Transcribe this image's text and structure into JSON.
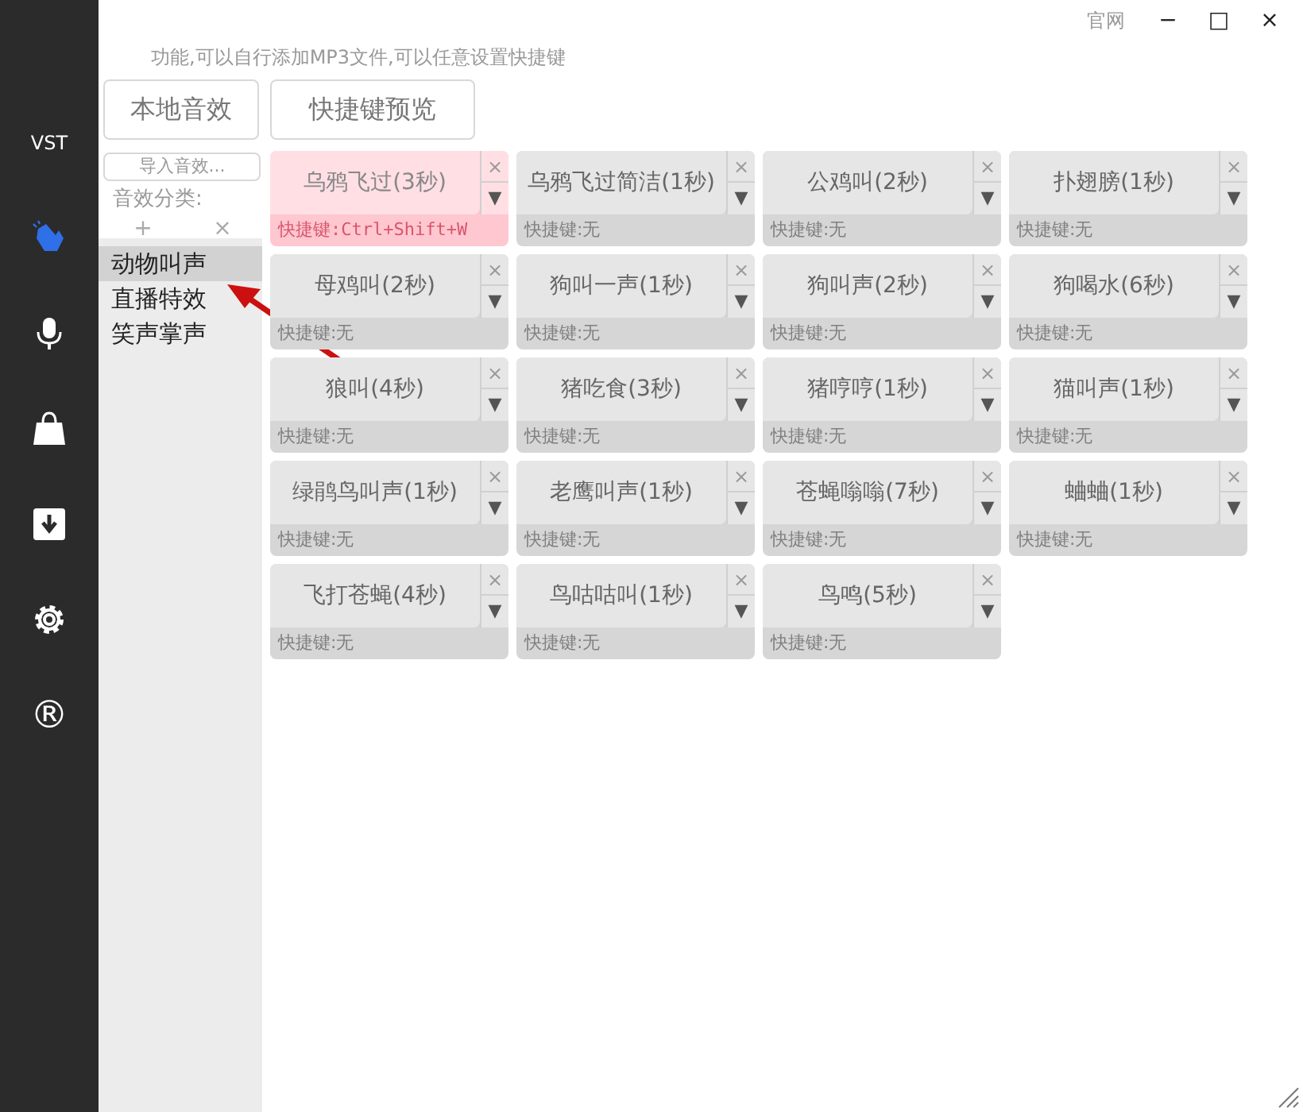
{
  "window": {
    "link": "官网",
    "controls": [
      "−",
      "□",
      "×"
    ]
  },
  "nav": [
    {
      "kind": "text",
      "label": "VST",
      "selected": false
    },
    {
      "kind": "clap",
      "selected": true
    },
    {
      "kind": "mic",
      "selected": false
    },
    {
      "kind": "bag",
      "selected": false
    },
    {
      "kind": "download",
      "selected": false
    },
    {
      "kind": "gear",
      "selected": false
    },
    {
      "kind": "text",
      "label": "®",
      "selected": false
    }
  ],
  "hint": "功能,可以自行添加MP3文件,可以任意设置快捷键",
  "tabs": [
    {
      "label": "本地音效"
    },
    {
      "label": "快捷键预览"
    }
  ],
  "import_button": "导入音效...",
  "category_label": "音效分类:",
  "category_actions": [
    "+",
    "×"
  ],
  "categories": [
    {
      "label": "动物叫声",
      "selected": true
    },
    {
      "label": "直播特效",
      "selected": false
    },
    {
      "label": "笑声掌声",
      "selected": false
    }
  ],
  "sounds": [
    {
      "name": "乌鸦飞过(3秒)",
      "shortcut": "快捷键:Ctrl+Shift+W",
      "selected": true
    },
    {
      "name": "乌鸦飞过简洁(1秒)",
      "shortcut": "快捷键:无",
      "selected": false
    },
    {
      "name": "公鸡叫(2秒)",
      "shortcut": "快捷键:无",
      "selected": false
    },
    {
      "name": "扑翅膀(1秒)",
      "shortcut": "快捷键:无",
      "selected": false
    },
    {
      "name": "母鸡叫(2秒)",
      "shortcut": "快捷键:无",
      "selected": false
    },
    {
      "name": "狗叫一声(1秒)",
      "shortcut": "快捷键:无",
      "selected": false
    },
    {
      "name": "狗叫声(2秒)",
      "shortcut": "快捷键:无",
      "selected": false
    },
    {
      "name": "狗喝水(6秒)",
      "shortcut": "快捷键:无",
      "selected": false
    },
    {
      "name": "狼叫(4秒)",
      "shortcut": "快捷键:无",
      "selected": false
    },
    {
      "name": "猪吃食(3秒)",
      "shortcut": "快捷键:无",
      "selected": false
    },
    {
      "name": "猪哼哼(1秒)",
      "shortcut": "快捷键:无",
      "selected": false
    },
    {
      "name": "猫叫声(1秒)",
      "shortcut": "快捷键:无",
      "selected": false
    },
    {
      "name": "绿鹃鸟叫声(1秒)",
      "shortcut": "快捷键:无",
      "selected": false
    },
    {
      "name": "老鹰叫声(1秒)",
      "shortcut": "快捷键:无",
      "selected": false
    },
    {
      "name": "苍蝇嗡嗡(7秒)",
      "shortcut": "快捷键:无",
      "selected": false
    },
    {
      "name": "蛐蛐(1秒)",
      "shortcut": "快捷键:无",
      "selected": false
    },
    {
      "name": "飞打苍蝇(4秒)",
      "shortcut": "快捷键:无",
      "selected": false
    },
    {
      "name": "鸟咕咕叫(1秒)",
      "shortcut": "快捷键:无",
      "selected": false
    },
    {
      "name": "鸟鸣(5秒)",
      "shortcut": "快捷键:无",
      "selected": false
    }
  ],
  "card_controls": {
    "remove": "×",
    "menu": "▼"
  }
}
